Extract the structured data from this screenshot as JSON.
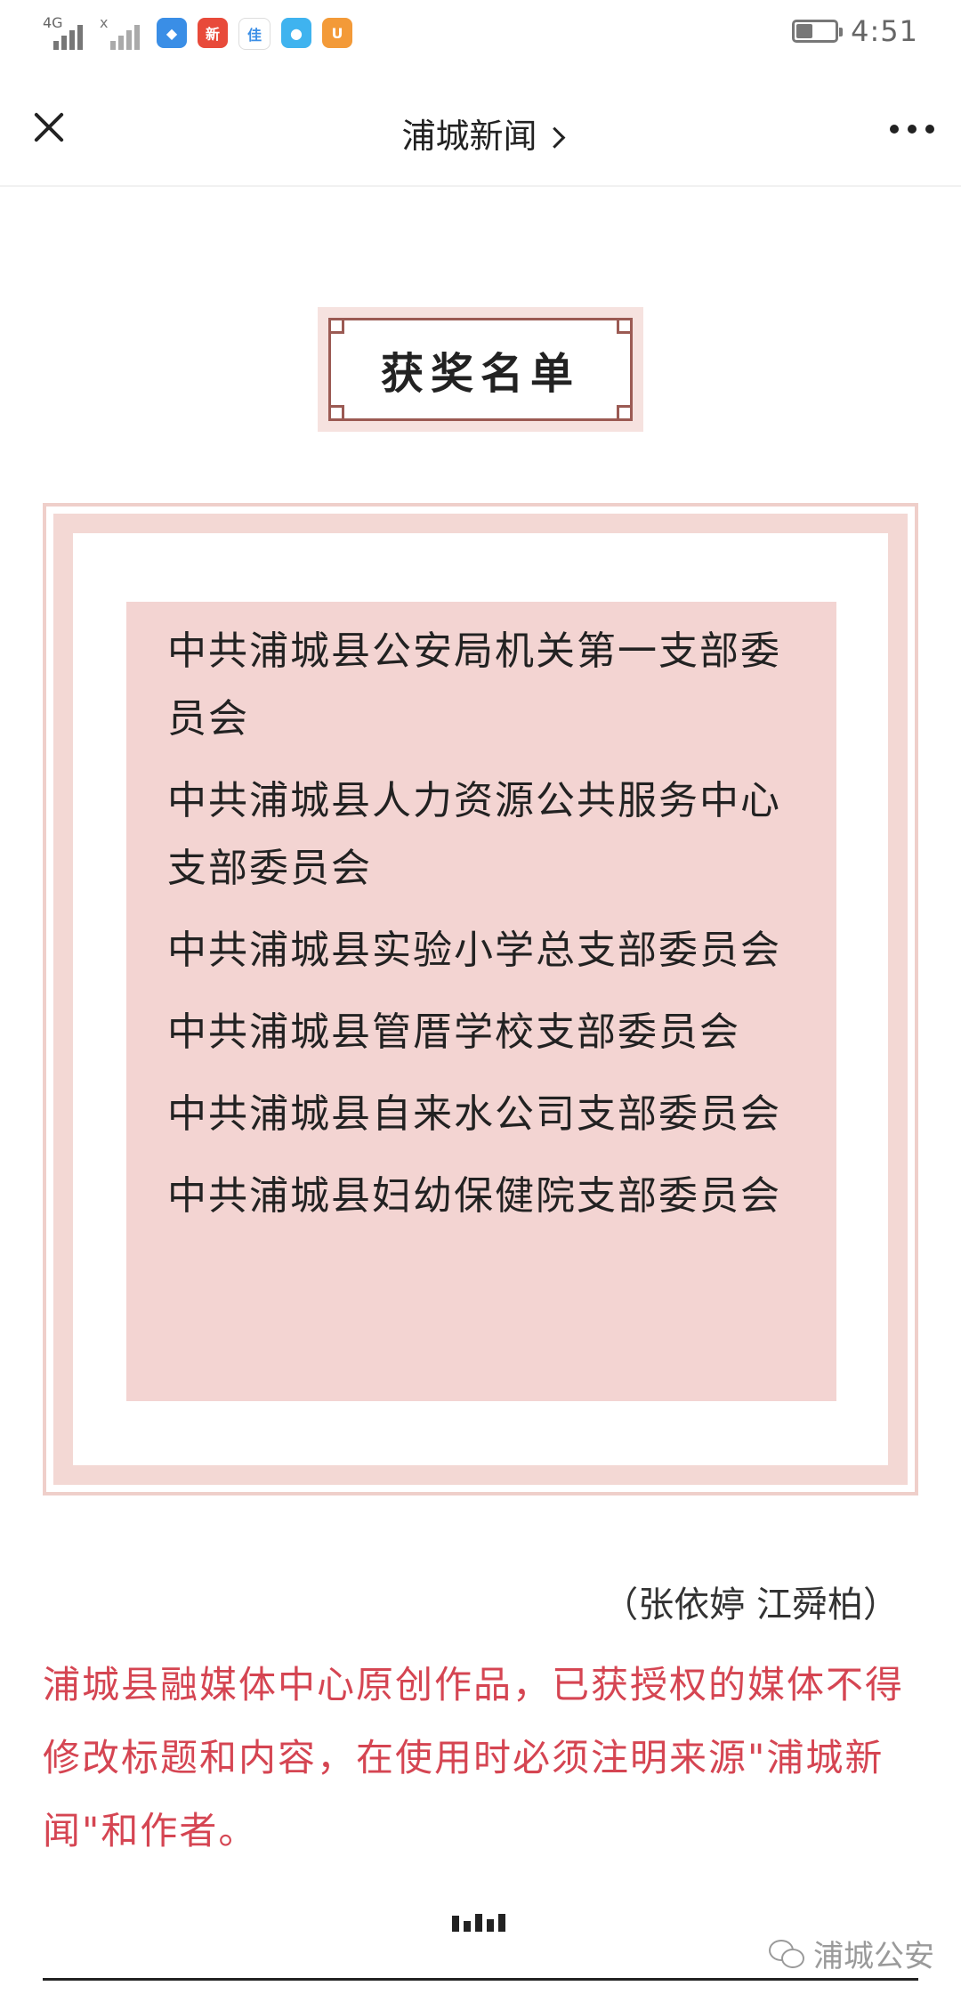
{
  "status_bar": {
    "network_1": "4G",
    "network_2": "x",
    "apps": [
      {
        "name": "shield-app-icon",
        "color": "#3a8ee6",
        "glyph": "◆"
      },
      {
        "name": "news-app-icon",
        "color": "#e84a3a",
        "glyph": "新"
      },
      {
        "name": "jia-app-icon",
        "color": "#ffffff",
        "glyph": "佳"
      },
      {
        "name": "browser-app-icon",
        "color": "#3fb3ef",
        "glyph": "●"
      },
      {
        "name": "uc-app-icon",
        "color": "#f39a38",
        "glyph": "U"
      }
    ],
    "battery_percent": 40,
    "time": "4:51"
  },
  "nav": {
    "title": "浦城新闻"
  },
  "heading": "获奖名单",
  "award_list": [
    "中共浦城县公安局机关第一支部委员会",
    "中共浦城县人力资源公共服务中心支部委员会",
    "中共浦城县实验小学总支部委员会",
    "中共浦城县管厝学校支部委员会",
    "中共浦城县自来水公司支部委员会",
    "中共浦城县妇幼保健院支部委员会"
  ],
  "authors": "（张依婷 江舜柏）",
  "notice": "浦城县融媒体中心原创作品，已获授权的媒体不得修改标题和内容，在使用时必须注明来源\"浦城新闻\"和作者。",
  "watermark": "浦城公安",
  "colors": {
    "accent_red": "#d54552",
    "panel_pink": "#f3d4d2",
    "frame_brown": "#9b5a53"
  }
}
